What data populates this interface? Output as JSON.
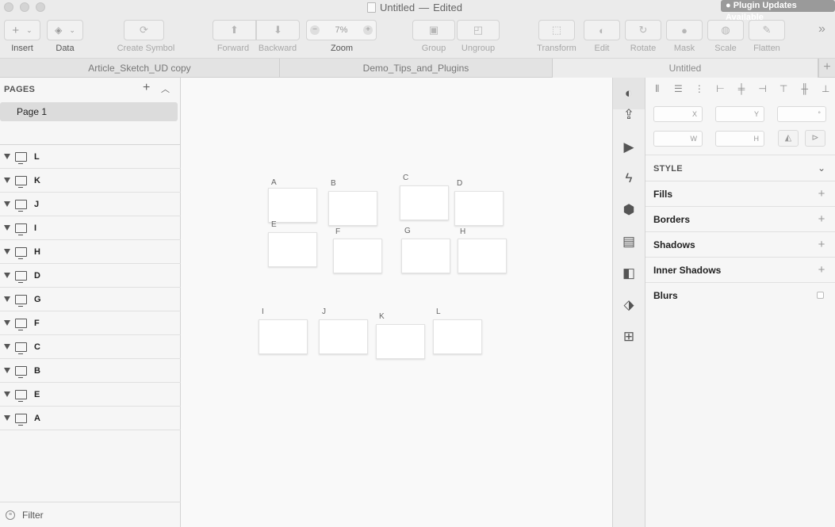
{
  "window": {
    "title": "Untitled",
    "status": "Edited",
    "title_separator": "—",
    "plugin_badge": "● Plugin Updates Available"
  },
  "toolbar": {
    "insert": "Insert",
    "data": "Data",
    "create_symbol": "Create Symbol",
    "forward": "Forward",
    "backward": "Backward",
    "zoom_value": "7%",
    "zoom_label": "Zoom",
    "group": "Group",
    "ungroup": "Ungroup",
    "transform": "Transform",
    "edit": "Edit",
    "rotate": "Rotate",
    "mask": "Mask",
    "scale": "Scale",
    "flatten": "Flatten"
  },
  "tabs": [
    {
      "label": "Article_Sketch_UD copy"
    },
    {
      "label": "Demo_Tips_and_Plugins"
    },
    {
      "label": "Untitled",
      "active": true
    }
  ],
  "sidebar": {
    "pages_title": "PAGES",
    "pages": [
      {
        "label": "Page 1",
        "selected": true
      }
    ],
    "layers": [
      {
        "name": "L"
      },
      {
        "name": "K"
      },
      {
        "name": "J"
      },
      {
        "name": "I"
      },
      {
        "name": "H"
      },
      {
        "name": "D"
      },
      {
        "name": "G"
      },
      {
        "name": "F"
      },
      {
        "name": "C"
      },
      {
        "name": "B"
      },
      {
        "name": "E"
      },
      {
        "name": "A"
      }
    ],
    "filter_placeholder": "Filter"
  },
  "canvas": {
    "artboards": [
      "A",
      "B",
      "C",
      "D",
      "E",
      "F",
      "G",
      "H",
      "I",
      "J",
      "K",
      "L"
    ]
  },
  "inspector": {
    "fields": {
      "x": "X",
      "y": "Y",
      "rotation": "°",
      "w": "W",
      "h": "H"
    },
    "style_title": "STYLE",
    "style_sections": [
      {
        "label": "Fills",
        "control": "plus"
      },
      {
        "label": "Borders",
        "control": "plus"
      },
      {
        "label": "Shadows",
        "control": "plus"
      },
      {
        "label": "Inner Shadows",
        "control": "plus"
      },
      {
        "label": "Blurs",
        "control": "checkbox"
      }
    ]
  }
}
